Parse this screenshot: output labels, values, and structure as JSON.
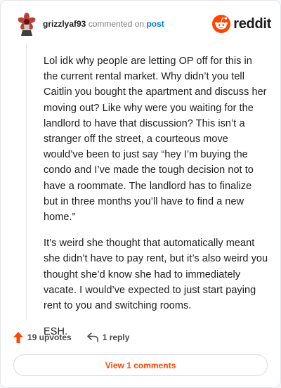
{
  "header": {
    "username": "grizzlyaf93",
    "action_text": "commented on",
    "post_link": "post",
    "brand": "reddit",
    "brand_color": "#ff4500"
  },
  "comment": {
    "paragraphs": [
      "Lol idk why people are letting OP off for this in the current rental market. Why didn’t you tell Caitlin you bought the apartment and discuss her moving out? Like why were you waiting for the landlord to have that discussion? This isn’t a stranger off the street, a courteous move would’ve been to just say “hey I’m buying the condo and I’ve made the tough decision not to have a roommate. The landlord has to finalize but in three months you’ll have to find a new home.”",
      "It’s weird she thought that automatically meant she didn’t have to pay rent, but it’s also weird you thought she’d know she had to immediately vacate. I would’ve expected to just start paying rent to you and switching rooms.",
      "ESH."
    ]
  },
  "footer": {
    "upvotes": "19 upvotes",
    "replies": "1 reply",
    "view_comments": "View 1 comments"
  },
  "icons": {
    "avatar": "demogorgon-avatar",
    "upvote": "upvote-arrow-icon",
    "reply": "reply-arrow-icon",
    "brand": "reddit-snoo-icon"
  }
}
